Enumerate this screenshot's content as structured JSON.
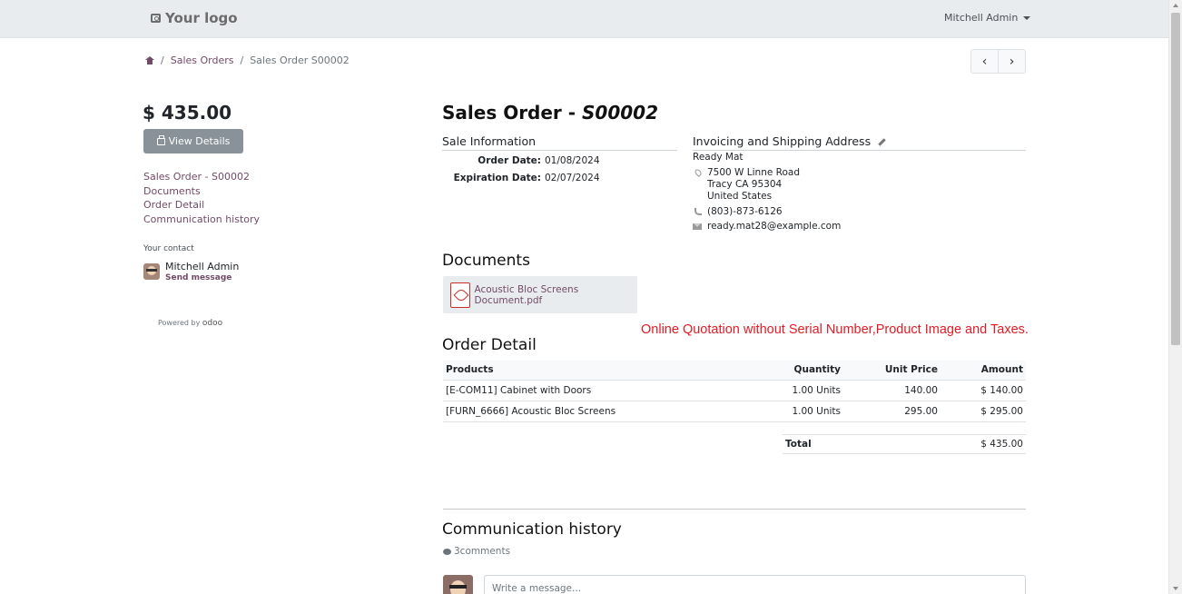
{
  "header": {
    "logo_text": "Your logo",
    "user": "Mitchell Admin"
  },
  "breadcrumb": {
    "items": [
      "Sales Orders",
      "Sales Order S00002"
    ]
  },
  "pager": {
    "prev": "‹",
    "next": "›"
  },
  "sidebar": {
    "amount": "$ 435.00",
    "view_details": "View Details",
    "nav": [
      "Sales Order - S00002",
      "Documents",
      "Order Detail",
      "Communication history"
    ],
    "contact_label": "Your contact",
    "contact_name": "Mitchell Admin",
    "send_message": "Send message",
    "powered_by": "Powered by",
    "powered_brand": "odoo"
  },
  "order": {
    "title_prefix": "Sales Order - ",
    "title_ref": "S00002",
    "sale_info_heading": "Sale Information",
    "order_date_label": "Order Date:",
    "order_date": "01/08/2024",
    "expiration_label": "Expiration Date:",
    "expiration_date": "02/07/2024",
    "address_heading": "Invoicing and Shipping Address",
    "customer": "Ready Mat",
    "street": "7500 W Linne Road",
    "city": "Tracy CA 95304",
    "country": "United States",
    "phone": "(803)-873-6126",
    "email": "ready.mat28@example.com"
  },
  "documents": {
    "heading": "Documents",
    "file": "Acoustic Bloc Screens Document.pdf"
  },
  "annotation": "Online Quotation without  Serial Number,Product Image and Taxes.",
  "order_detail": {
    "heading": "Order Detail",
    "columns": [
      "Products",
      "Quantity",
      "Unit Price",
      "Amount"
    ],
    "rows": [
      [
        "[E-COM11] Cabinet with Doors",
        "1.00 Units",
        "140.00",
        "$ 140.00"
      ],
      [
        "[FURN_6666] Acoustic Bloc Screens",
        "1.00 Units",
        "295.00",
        "$ 295.00"
      ]
    ],
    "total_label": "Total",
    "total_value": "$ 435.00"
  },
  "communication": {
    "heading": "Communication history",
    "comments": "3comments",
    "placeholder": "Write a message..."
  }
}
